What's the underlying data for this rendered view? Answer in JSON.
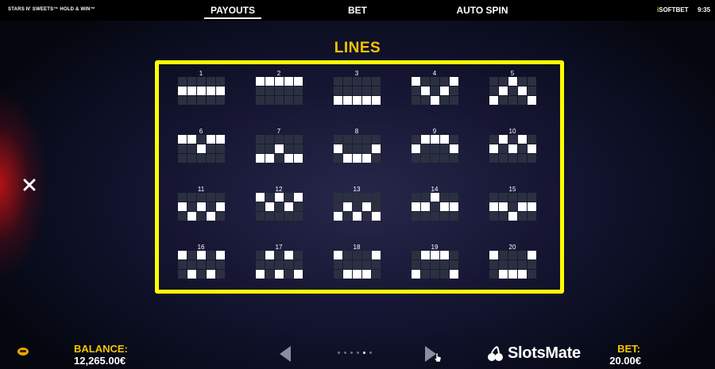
{
  "header": {
    "game_title": "STARS N' SWEETS™ HOLD & WIN™",
    "tabs": [
      {
        "label": "PAYOUTS",
        "active": true
      },
      {
        "label": "BET",
        "active": false
      },
      {
        "label": "AUTO SPIN",
        "active": false
      }
    ],
    "brand_prefix": "i",
    "brand_name": "SOFTBET",
    "time": "9:35"
  },
  "section_title": "LINES",
  "paylines": [
    {
      "number": "1",
      "rows": [
        1,
        1,
        1,
        1,
        1
      ]
    },
    {
      "number": "2",
      "rows": [
        0,
        0,
        0,
        0,
        0
      ]
    },
    {
      "number": "3",
      "rows": [
        2,
        2,
        2,
        2,
        2
      ]
    },
    {
      "number": "4",
      "rows": [
        0,
        1,
        2,
        1,
        0
      ]
    },
    {
      "number": "5",
      "rows": [
        2,
        1,
        0,
        1,
        2
      ]
    },
    {
      "number": "6",
      "rows": [
        0,
        0,
        1,
        0,
        0
      ]
    },
    {
      "number": "7",
      "rows": [
        2,
        2,
        1,
        2,
        2
      ]
    },
    {
      "number": "8",
      "rows": [
        1,
        2,
        2,
        2,
        1
      ]
    },
    {
      "number": "9",
      "rows": [
        1,
        0,
        0,
        0,
        1
      ]
    },
    {
      "number": "10",
      "rows": [
        1,
        0,
        1,
        0,
        1
      ]
    },
    {
      "number": "11",
      "rows": [
        1,
        2,
        1,
        2,
        1
      ]
    },
    {
      "number": "12",
      "rows": [
        0,
        1,
        0,
        1,
        0
      ]
    },
    {
      "number": "13",
      "rows": [
        2,
        1,
        2,
        1,
        2
      ]
    },
    {
      "number": "14",
      "rows": [
        1,
        1,
        0,
        1,
        1
      ]
    },
    {
      "number": "15",
      "rows": [
        1,
        1,
        2,
        1,
        1
      ]
    },
    {
      "number": "16",
      "rows": [
        0,
        2,
        0,
        2,
        0
      ]
    },
    {
      "number": "17",
      "rows": [
        2,
        0,
        2,
        0,
        2
      ]
    },
    {
      "number": "18",
      "rows": [
        0,
        2,
        2,
        2,
        0
      ]
    },
    {
      "number": "19",
      "rows": [
        2,
        0,
        0,
        0,
        2
      ]
    },
    {
      "number": "20",
      "rows": [
        0,
        2,
        2,
        2,
        0
      ]
    }
  ],
  "footer": {
    "balance_label": "BALANCE:",
    "balance_value": "12,265.00€",
    "bet_label": "BET:",
    "bet_value": "20.00€",
    "page_count": 6,
    "active_page": 5,
    "watermark": "SlotsMate"
  },
  "icons": {
    "close": "close-icon",
    "prev": "triangle-left-icon",
    "next": "triangle-right-icon",
    "chip": "chip-icon",
    "cursor": "hand-cursor-icon",
    "watermark_logo": "cherry-logo-icon"
  },
  "colors": {
    "accent_yellow": "#f5c400",
    "frame_yellow": "#ffff00",
    "cell_off": "#2b3040",
    "cell_on": "#ffffff"
  }
}
